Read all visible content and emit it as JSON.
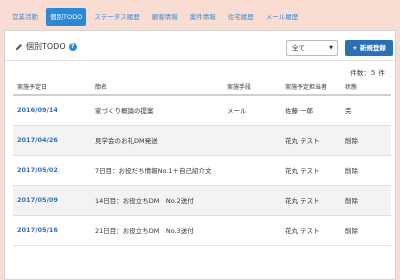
{
  "nav": {
    "tabs": [
      {
        "label": "営業活動",
        "active": false
      },
      {
        "label": "個別TODO",
        "active": true
      },
      {
        "label": "ステータス履歴",
        "active": false
      },
      {
        "label": "顧客情報",
        "active": false
      },
      {
        "label": "案件情報",
        "active": false
      },
      {
        "label": "住宅履歴",
        "active": false
      },
      {
        "label": "メール履歴",
        "active": false
      }
    ]
  },
  "panel": {
    "title": "個別TODO",
    "filter_value": "全て",
    "new_button_label": "+ 新規登録",
    "count_text": "件数：５ 件"
  },
  "table": {
    "columns": [
      "実施予定日",
      "簡名",
      "実施手段",
      "実施予定担当者",
      "状態"
    ],
    "rows": [
      {
        "date": "2016/09/14",
        "name": "家づくり概論の提案",
        "method": "メール",
        "assignee": "佐藤 一郎",
        "status": "完"
      },
      {
        "date": "2017/04/26",
        "name": "見学会のお礼DM発送",
        "method": "",
        "assignee": "花丸 テスト",
        "status": "削除"
      },
      {
        "date": "2017/05/02",
        "name": "7日目：お役だち情報No.1＋自己紹介文",
        "method": "",
        "assignee": "花丸 テスト",
        "status": "削除"
      },
      {
        "date": "2017/05/09",
        "name": "14日目：お役立ちDM　No.2送付",
        "method": "",
        "assignee": "花丸 テスト",
        "status": "削除"
      },
      {
        "date": "2017/05/16",
        "name": "21日目：お役立ちDM　No.3送付",
        "method": "",
        "assignee": "花丸 テスト",
        "status": "削除"
      }
    ]
  }
}
